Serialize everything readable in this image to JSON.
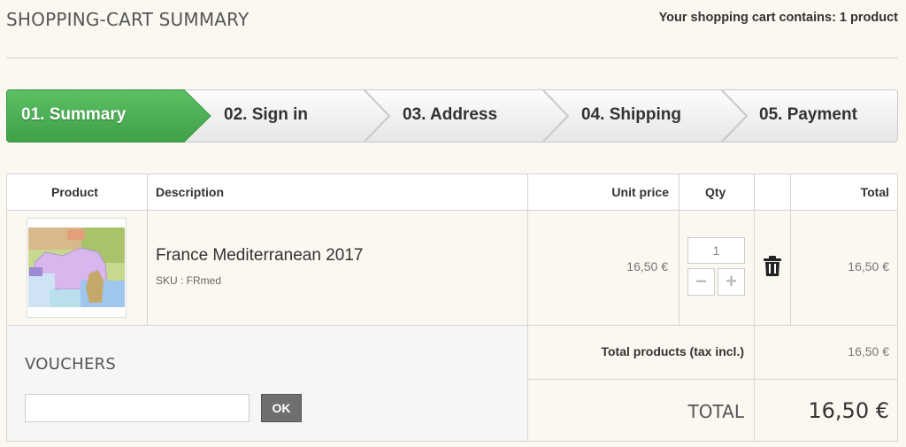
{
  "header": {
    "title": "SHOPPING-CART SUMMARY",
    "cart_count_text": "Your shopping cart contains: 1 product"
  },
  "steps": [
    {
      "label": "01. Summary",
      "active": true
    },
    {
      "label": "02. Sign in",
      "active": false
    },
    {
      "label": "03. Address",
      "active": false
    },
    {
      "label": "04. Shipping",
      "active": false
    },
    {
      "label": "05. Payment",
      "active": false
    }
  ],
  "table": {
    "headers": {
      "product": "Product",
      "description": "Description",
      "unit_price": "Unit price",
      "qty": "Qty",
      "total": "Total"
    },
    "item": {
      "name": "France Mediterranean 2017",
      "sku": "SKU : FRmed",
      "unit_price": "16,50 €",
      "qty": "1",
      "total": "16,50 €",
      "minus_icon": "minus-icon",
      "plus_icon": "plus-icon",
      "delete_icon": "trash-icon"
    }
  },
  "vouchers": {
    "title": "VOUCHERS",
    "input_value": "",
    "ok_label": "OK"
  },
  "totals": {
    "products_label": "Total products (tax incl.)",
    "products_value": "16,50 €",
    "grand_label": "TOTAL",
    "grand_value": "16,50 €"
  },
  "colors": {
    "active_step": "#46a74e",
    "background": "#fbf8f1"
  }
}
